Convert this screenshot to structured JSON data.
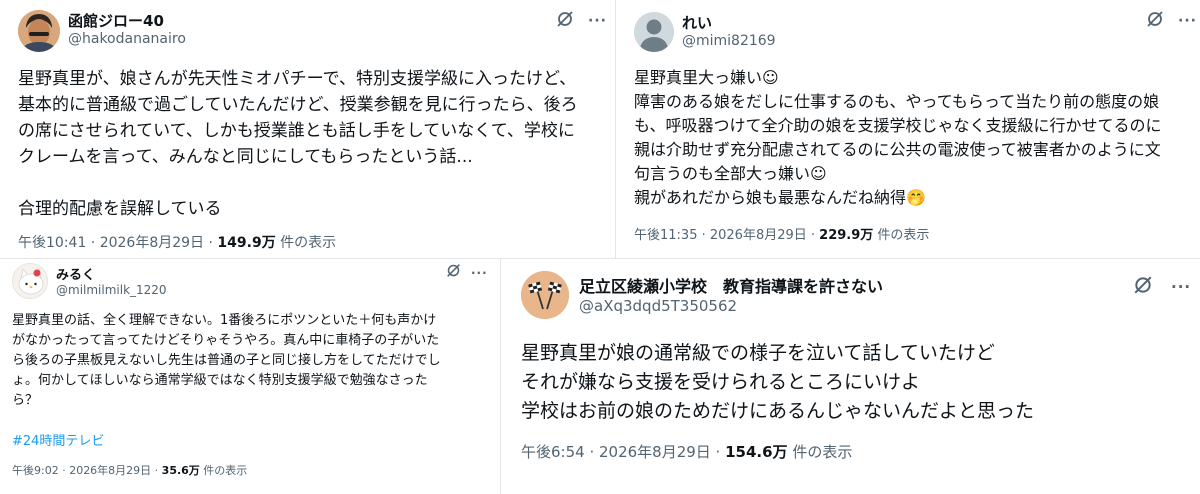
{
  "posts": [
    {
      "name": "函館ジロー40",
      "handle": "@hakodananairo",
      "body": "星野真里が、娘さんが先天性ミオパチーで、特別支援学級に入ったけど、\n基本的に普通級で過ごしていたんだけど、授業参観を見に行ったら、後ろ\nの席にさせられていて、しかも授業誰とも話し手をしていなくて、学校に\nクレームを言って、みんなと同じにしてもらったという話...\n\n合理的配慮を誤解している",
      "time": "午後10:41 · 2026年8月29日 · ",
      "views": "149.9万",
      "views_suffix": " 件の表示",
      "avatar_icon": "person-avatar-icon"
    },
    {
      "name": "れい",
      "handle": "@mimi82169",
      "body": "星野真里大っ嫌い☺\n障害のある娘をだしに仕事するのも、やってもらって当たり前の態度の娘\nも、呼吸器つけて全介助の娘を支援学校じゃなく支援級に行かせてるのに\n親は介助せず充分配慮されてるのに公共の電波使って被害者かのように文\n句言うのも全部大っ嫌い☺\n親があれだから娘も最悪なんだね納得🤭",
      "time": "午後11:35 · 2026年8月29日 · ",
      "views": "229.9万",
      "views_suffix": " 件の表示",
      "avatar_icon": "default-profile-icon"
    },
    {
      "name": "みるく",
      "handle": "@milmilmilk_1220",
      "body": "星野真里の話、全く理解できない。1番後ろにポツンといた＋何も声かけ\nがなかったって言ってたけどそりゃそうやろ。真ん中に車椅子の子がいた\nら後ろの子黒板見えないし先生は普通の子と同じ接し方をしてただけでし\nょ。何かしてほしいなら通常学級ではなく特別支援学級で勉強なさった\nら？",
      "hashtag": "#24時間テレビ",
      "time": "午後9:02 · 2026年8月29日 · ",
      "views": "35.6万",
      "views_suffix": " 件の表示",
      "avatar_icon": "cat-avatar-icon"
    },
    {
      "name": "足立区綾瀬小学校　教育指導課を許さない",
      "handle": "@aXq3dqd5T350562",
      "body": "星野真里が娘の通常級での様子を泣いて話していたけど\nそれが嫌なら支援を受けられるところにいけよ\n学校はお前の娘のためだけにあるんじゃないんだよと思った",
      "time": "午後6:54 · 2026年8月29日 · ",
      "views": "154.6万",
      "views_suffix": " 件の表示",
      "avatar_icon": "checkered-flags-icon"
    }
  ],
  "ui": {
    "more_label": "···",
    "grok_icon": "grok-icon",
    "link_color": "#1d9bf0",
    "secondary_color": "#536471"
  }
}
